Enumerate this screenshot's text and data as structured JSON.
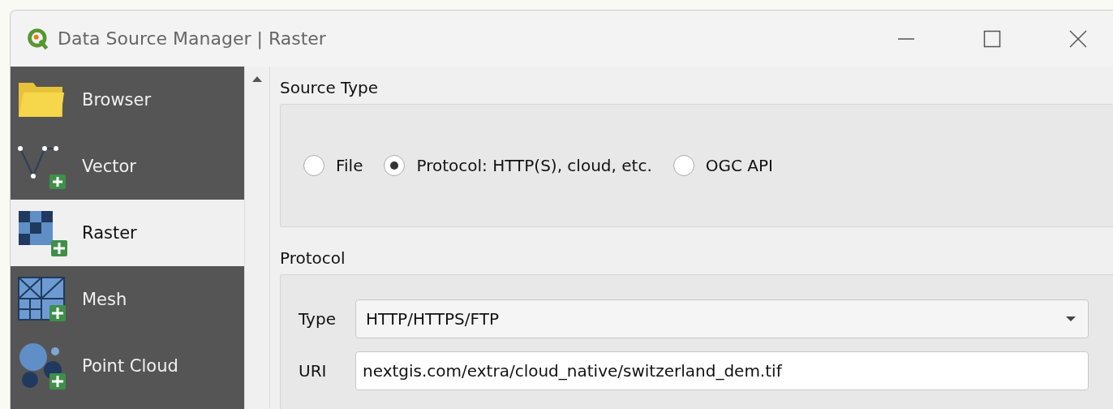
{
  "window": {
    "title": "Data Source Manager | Raster"
  },
  "sidebar": {
    "items": [
      {
        "label": "Browser",
        "kind": "browser",
        "selected": false
      },
      {
        "label": "Vector",
        "kind": "vector",
        "selected": false
      },
      {
        "label": "Raster",
        "kind": "raster",
        "selected": true
      },
      {
        "label": "Mesh",
        "kind": "mesh",
        "selected": false
      },
      {
        "label": "Point Cloud",
        "kind": "pointcloud",
        "selected": false
      }
    ]
  },
  "source_type": {
    "title": "Source Type",
    "options": [
      {
        "label": "File",
        "selected": false
      },
      {
        "label": "Protocol: HTTP(S), cloud, etc.",
        "selected": true
      },
      {
        "label": "OGC API",
        "selected": false
      }
    ]
  },
  "protocol": {
    "title": "Protocol",
    "type_label": "Type",
    "type_value": "HTTP/HTTPS/FTP",
    "uri_label": "URI",
    "uri_value": "nextgis.com/extra/cloud_native/switzerland_dem.tif"
  }
}
